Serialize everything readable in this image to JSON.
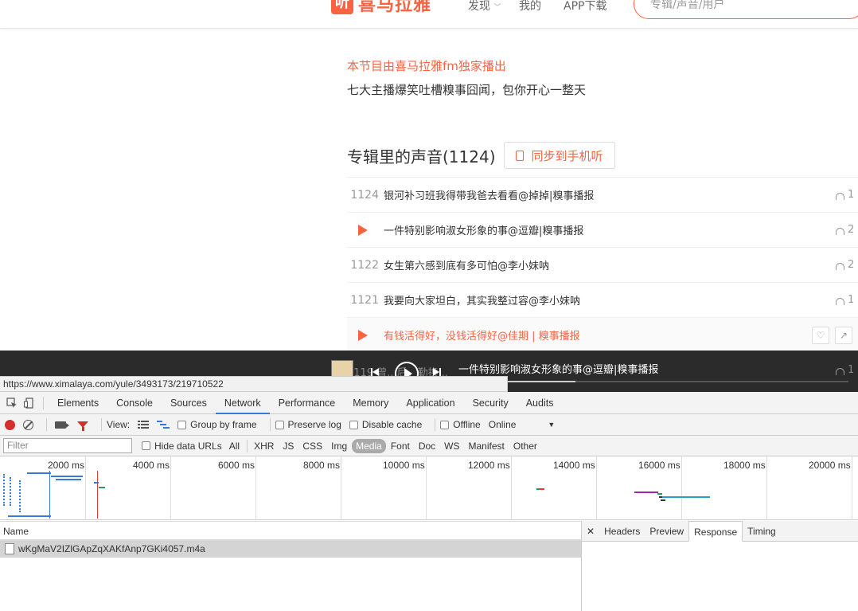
{
  "header": {
    "logo_text": "喜马拉雅",
    "nav": [
      "发现",
      "我的",
      "APP下载"
    ],
    "search_placeholder": "专辑/声音/用户"
  },
  "album": {
    "slogan": "本节目由喜马拉雅fm独家播出",
    "description": "七大主播爆笑吐槽糗事囧闻，包你开心一整天",
    "section_title": "专辑里的声音(1124)",
    "sync_button": "同步到手机听"
  },
  "tracks": [
    {
      "num": "1124",
      "title": "银河补习班我得带我爸去看看@掉掉|糗事播报",
      "plays": "1",
      "playing": false
    },
    {
      "num": "",
      "title": "一件特别影响淑女形象的事@逗瓣|糗事播报",
      "plays": "2",
      "playing": true
    },
    {
      "num": "1122",
      "title": "女生第六感到底有多可怕@李小妹呐",
      "plays": "2",
      "playing": false
    },
    {
      "num": "1121",
      "title": "我要向大家坦白，其实我整过容@李小妹呐",
      "plays": "1",
      "playing": false
    },
    {
      "num": "",
      "title": "有钱活得好，没钱活得好@佳期 | 糗事播报",
      "plays": "",
      "playing": true,
      "highlight": true
    }
  ],
  "player": {
    "now_playing": "一件特别影响淑女形象的事@逗瓣|糗事播报",
    "ghost_num": "1119",
    "ghost_text": "曾...后，勤换...",
    "ghost_plays": "1",
    "progress": 0.3
  },
  "url_tooltip": "https://www.ximalaya.com/yule/3493173/219710522",
  "devtools": {
    "tabs": [
      "Elements",
      "Console",
      "Sources",
      "Network",
      "Performance",
      "Memory",
      "Application",
      "Security",
      "Audits"
    ],
    "active_tab": "Network",
    "toolbar": {
      "view_label": "View:",
      "group_by_frame": "Group by frame",
      "preserve_log": "Preserve log",
      "disable_cache": "Disable cache",
      "offline": "Offline",
      "throttle": "Online"
    },
    "filter": {
      "placeholder": "Filter",
      "hide_data_urls": "Hide data URLs",
      "types": [
        "All",
        "XHR",
        "JS",
        "CSS",
        "Img",
        "Media",
        "Font",
        "Doc",
        "WS",
        "Manifest",
        "Other"
      ],
      "active_type": "Media"
    },
    "timeline_ticks": [
      "2000 ms",
      "4000 ms",
      "6000 ms",
      "8000 ms",
      "10000 ms",
      "12000 ms",
      "14000 ms",
      "16000 ms",
      "18000 ms",
      "20000 ms"
    ],
    "requests_header": "Name",
    "requests": [
      "wKgMaV2IZlGApZqXAKfAnp7GKi4057.m4a"
    ],
    "detail_tabs": [
      "Headers",
      "Preview",
      "Response",
      "Timing"
    ],
    "detail_active": "Response"
  },
  "colors": {
    "brand": "#f86442",
    "devtools_accent": "#3879d9",
    "record": "#d32f2f"
  }
}
